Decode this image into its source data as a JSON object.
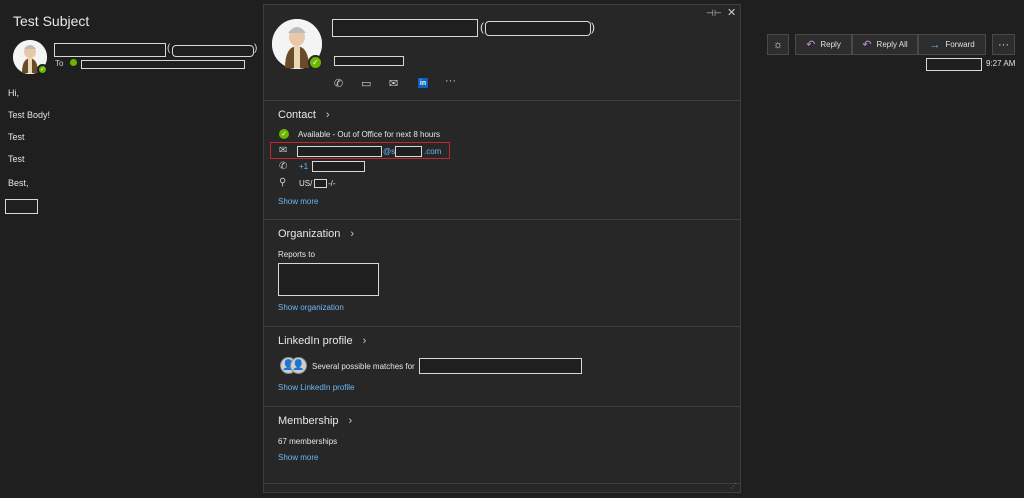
{
  "message": {
    "subject": "Test Subject",
    "to_label": "To",
    "time": "9:27 AM",
    "body_lines": [
      "Hi,",
      "Test Body!",
      "Test",
      "Test",
      "Best,"
    ]
  },
  "toolbar": {
    "reply_label": "Reply",
    "reply_all_label": "Reply All",
    "forward_label": "Forward",
    "more_label": "···"
  },
  "card": {
    "contact": {
      "heading": "Contact",
      "status": "Available - Out of Office for next 8 hours",
      "email_at": "@s",
      "email_domain_suffix": ".com",
      "phone_prefix": "+1",
      "location_prefix": "US/",
      "location_suffix": "-/-",
      "show_more": "Show more"
    },
    "organization": {
      "heading": "Organization",
      "reports_to": "Reports to",
      "show_organization": "Show organization"
    },
    "linkedin": {
      "heading": "LinkedIn profile",
      "matches_text": "Several possible matches for",
      "show_profile": "Show LinkedIn profile",
      "badge": "in"
    },
    "membership": {
      "heading": "Membership",
      "count_text": "67 memberships",
      "show_more": "Show more"
    }
  },
  "icons": {
    "presence_available": "#6bb700",
    "link_color": "#6cb8f6",
    "highlight_border": "#c4262e"
  }
}
